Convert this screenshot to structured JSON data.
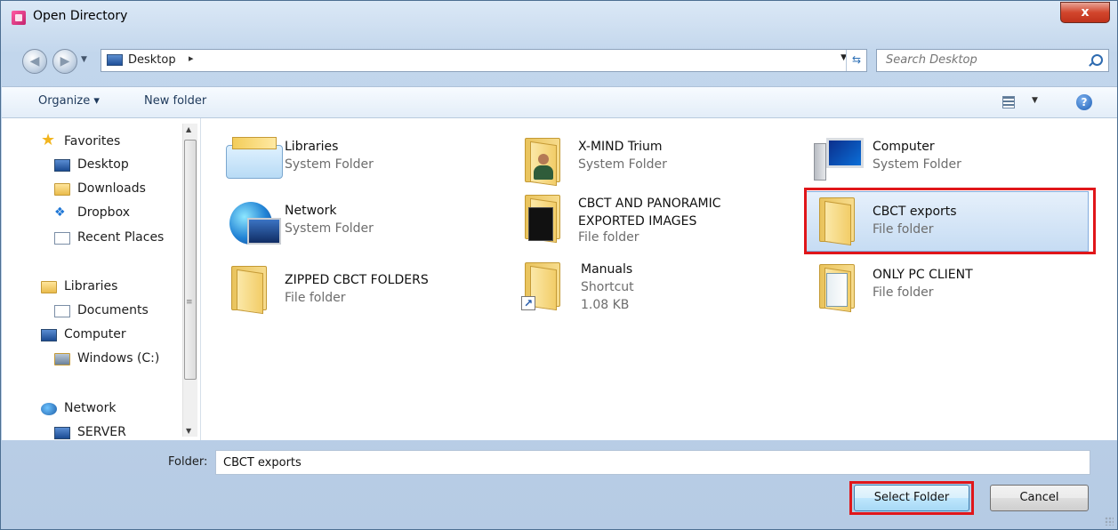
{
  "window": {
    "title": "Open Directory",
    "close_label": "x"
  },
  "address": {
    "location": "Desktop",
    "separator": "▸"
  },
  "search": {
    "placeholder": "Search Desktop"
  },
  "commands": {
    "organize": "Organize ▾",
    "new_folder": "New folder"
  },
  "sidebar": {
    "items": [
      {
        "label": "Favorites",
        "icon": "star-icon"
      },
      {
        "label": "Desktop",
        "icon": "desktop-icon"
      },
      {
        "label": "Downloads",
        "icon": "downloads-icon"
      },
      {
        "label": "Dropbox",
        "icon": "dropbox-icon"
      },
      {
        "label": "Recent Places",
        "icon": "recent-places-icon"
      },
      {
        "label": "Libraries",
        "icon": "libraries-icon"
      },
      {
        "label": "Documents",
        "icon": "documents-icon"
      },
      {
        "label": "Computer",
        "icon": "computer-icon"
      },
      {
        "label": "Windows (C:)",
        "icon": "drive-icon"
      },
      {
        "label": "Network",
        "icon": "network-icon"
      },
      {
        "label": "SERVER",
        "icon": "server-icon"
      }
    ]
  },
  "files": [
    {
      "name": "Libraries",
      "type": "System Folder"
    },
    {
      "name": "X-MIND Trium",
      "type": "System Folder"
    },
    {
      "name": "Computer",
      "type": "System Folder"
    },
    {
      "name": "Network",
      "type": "System Folder"
    },
    {
      "name": "CBCT AND PANORAMIC EXPORTED IMAGES",
      "type": "File folder"
    },
    {
      "name": "CBCT exports",
      "type": "File folder",
      "selected": true
    },
    {
      "name": "ZIPPED CBCT FOLDERS",
      "type": "File folder"
    },
    {
      "name": "Manuals",
      "type": "Shortcut",
      "size": "1.08 KB"
    },
    {
      "name": "ONLY PC CLIENT",
      "type": "File folder"
    }
  ],
  "footer": {
    "folder_label": "Folder:",
    "folder_value": "CBCT exports",
    "select_button": "Select Folder",
    "cancel_button": "Cancel"
  },
  "colors": {
    "highlight_outline": "#e0161a",
    "selection": "#c6dcf3"
  }
}
